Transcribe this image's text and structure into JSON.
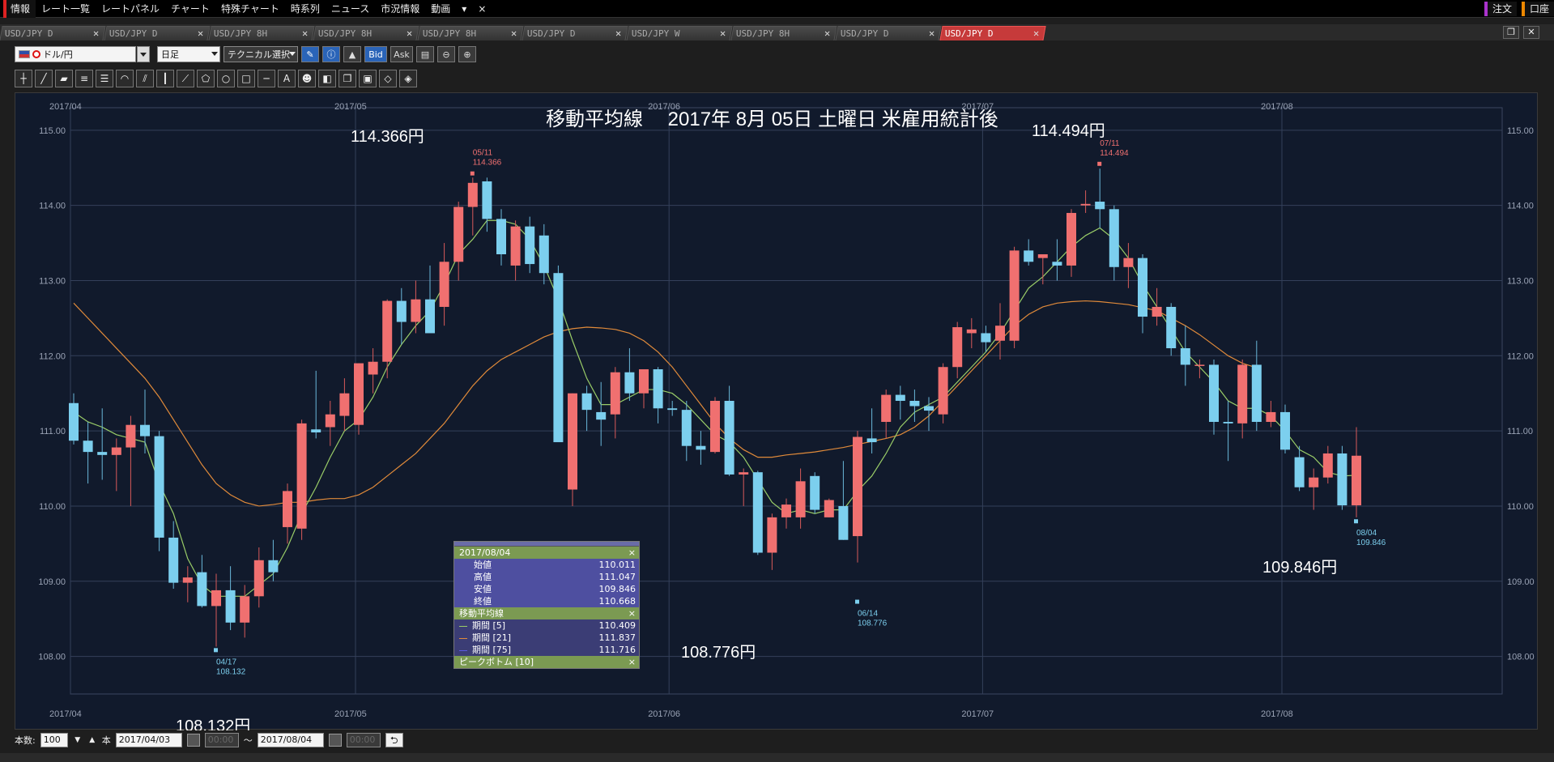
{
  "menu": {
    "items": [
      "情報",
      "レート一覧",
      "レートパネル",
      "チャート",
      "特殊チャート",
      "時系列",
      "ニュース",
      "市況情報",
      "動画"
    ],
    "more": "▾",
    "close": "×",
    "order_button": "注文",
    "account_button": "口座"
  },
  "tabs": [
    {
      "label": "USD/JPY D",
      "active": false
    },
    {
      "label": "USD/JPY D",
      "active": false
    },
    {
      "label": "USD/JPY 8H",
      "active": false
    },
    {
      "label": "USD/JPY 8H",
      "active": false
    },
    {
      "label": "USD/JPY 8H",
      "active": false
    },
    {
      "label": "USD/JPY D",
      "active": false
    },
    {
      "label": "USD/JPY W",
      "active": false
    },
    {
      "label": "USD/JPY 8H",
      "active": false
    },
    {
      "label": "USD/JPY D",
      "active": false
    },
    {
      "label": "USD/JPY D",
      "active": true
    }
  ],
  "toolbar": {
    "pair": "ドル/円",
    "timeframe": "日足",
    "technical": "テクニカル選択",
    "bid": "Bid",
    "ask": "Ask"
  },
  "popup": {
    "date": "2017/08/04",
    "close_x": "×",
    "ohlc": [
      {
        "label": "始値",
        "value": "110.011"
      },
      {
        "label": "高値",
        "value": "111.047"
      },
      {
        "label": "安値",
        "value": "109.846"
      },
      {
        "label": "終値",
        "value": "110.668"
      }
    ],
    "ma_header": "移動平均線",
    "ma": [
      {
        "label": "期間 [5]",
        "value": "110.409",
        "color": "#9acd68"
      },
      {
        "label": "期間 [21]",
        "value": "111.837",
        "color": "#e08a3a"
      },
      {
        "label": "期間 [75]",
        "value": "111.716",
        "color": "#5a5ae0"
      }
    ],
    "peak_header": "ピークボトム [10]"
  },
  "bottom": {
    "count_label": "本数:",
    "count_value": "100",
    "unit": "本",
    "from_date": "2017/04/03",
    "from_time": "00:00",
    "tilde": "〜",
    "to_date": "2017/08/04",
    "to_time": "00:00",
    "undo": "⮌"
  },
  "chart_data": {
    "type": "candlestick",
    "title": "移動平均線 　2017年 8月 05日 土曜日 米雇用統計後",
    "ylim": [
      107.5,
      115.3
    ],
    "y_ticks": [
      "115.00",
      "114.00",
      "113.00",
      "112.00",
      "111.00",
      "110.00",
      "109.00",
      "108.00"
    ],
    "x_month_labels": [
      {
        "label": "2017/04",
        "index": 0
      },
      {
        "label": "2017/05",
        "index": 20
      },
      {
        "label": "2017/06",
        "index": 42
      },
      {
        "label": "2017/07",
        "index": 64
      },
      {
        "label": "2017/08",
        "index": 85
      }
    ],
    "up_color": "#f07070",
    "down_color": "#7ccfee",
    "candles": [
      [
        111.37,
        111.5,
        110.82,
        110.87
      ],
      [
        110.87,
        111.12,
        110.3,
        110.72
      ],
      [
        110.72,
        111.3,
        110.35,
        110.68
      ],
      [
        110.68,
        110.9,
        110.2,
        110.78
      ],
      [
        110.78,
        111.2,
        110.0,
        111.08
      ],
      [
        111.08,
        111.55,
        110.7,
        110.93
      ],
      [
        110.93,
        111.0,
        109.4,
        109.58
      ],
      [
        109.58,
        109.8,
        108.9,
        108.98
      ],
      [
        108.98,
        109.2,
        108.72,
        109.05
      ],
      [
        109.12,
        109.35,
        108.65,
        108.67
      ],
      [
        108.67,
        109.1,
        108.13,
        108.88
      ],
      [
        108.88,
        109.2,
        108.35,
        108.45
      ],
      [
        108.45,
        108.95,
        108.25,
        108.8
      ],
      [
        108.8,
        109.45,
        108.65,
        109.28
      ],
      [
        109.28,
        109.55,
        109.0,
        109.12
      ],
      [
        109.72,
        110.3,
        109.5,
        110.2
      ],
      [
        109.7,
        111.15,
        109.55,
        111.1
      ],
      [
        111.02,
        111.8,
        110.9,
        110.98
      ],
      [
        111.05,
        111.4,
        110.8,
        111.22
      ],
      [
        111.2,
        111.7,
        111.0,
        111.5
      ],
      [
        111.08,
        111.9,
        110.95,
        111.9
      ],
      [
        111.75,
        112.1,
        111.5,
        111.92
      ],
      [
        111.92,
        112.75,
        111.7,
        112.73
      ],
      [
        112.73,
        112.9,
        112.15,
        112.45
      ],
      [
        112.45,
        113.0,
        112.3,
        112.75
      ],
      [
        112.75,
        113.2,
        112.55,
        112.3
      ],
      [
        112.65,
        113.5,
        112.4,
        113.25
      ],
      [
        113.25,
        114.05,
        113.0,
        113.98
      ],
      [
        113.98,
        114.37,
        113.6,
        114.3
      ],
      [
        114.32,
        114.37,
        113.65,
        113.82
      ],
      [
        113.82,
        113.95,
        113.2,
        113.35
      ],
      [
        113.2,
        113.8,
        113.0,
        113.72
      ],
      [
        113.72,
        113.85,
        113.1,
        113.22
      ],
      [
        113.6,
        113.75,
        112.95,
        113.1
      ],
      [
        113.1,
        113.2,
        110.85,
        110.85
      ],
      [
        110.22,
        111.5,
        110.0,
        111.5
      ],
      [
        111.5,
        111.6,
        111.0,
        111.28
      ],
      [
        111.25,
        111.65,
        110.8,
        111.15
      ],
      [
        111.22,
        111.85,
        110.9,
        111.78
      ],
      [
        111.78,
        112.1,
        111.4,
        111.5
      ],
      [
        111.5,
        111.8,
        111.3,
        111.82
      ],
      [
        111.82,
        111.85,
        111.1,
        111.3
      ],
      [
        111.3,
        111.4,
        111.2,
        111.28
      ],
      [
        111.28,
        111.4,
        110.6,
        110.8
      ],
      [
        110.8,
        111.0,
        110.55,
        110.75
      ],
      [
        110.72,
        111.45,
        110.7,
        111.4
      ],
      [
        111.4,
        111.6,
        110.4,
        110.42
      ],
      [
        110.42,
        110.5,
        110.0,
        110.45
      ],
      [
        110.45,
        110.47,
        109.35,
        109.38
      ],
      [
        109.38,
        109.9,
        109.15,
        109.85
      ],
      [
        109.85,
        110.1,
        109.7,
        110.02
      ],
      [
        109.85,
        110.5,
        109.7,
        110.33
      ],
      [
        110.4,
        110.45,
        109.9,
        109.95
      ],
      [
        109.85,
        110.1,
        109.85,
        110.08
      ],
      [
        110.0,
        110.6,
        109.55,
        109.55
      ],
      [
        109.6,
        111.0,
        109.25,
        110.92
      ],
      [
        110.9,
        111.3,
        110.7,
        110.85
      ],
      [
        111.12,
        111.55,
        110.9,
        111.48
      ],
      [
        111.48,
        111.6,
        111.15,
        111.4
      ],
      [
        111.4,
        111.55,
        111.12,
        111.33
      ],
      [
        111.33,
        111.45,
        111.0,
        111.27
      ],
      [
        111.22,
        111.9,
        111.1,
        111.85
      ],
      [
        111.85,
        112.45,
        111.7,
        112.38
      ],
      [
        112.3,
        112.5,
        112.1,
        112.35
      ],
      [
        112.3,
        112.4,
        112.05,
        112.18
      ],
      [
        112.2,
        112.7,
        111.95,
        112.4
      ],
      [
        112.2,
        113.45,
        112.1,
        113.4
      ],
      [
        113.4,
        113.55,
        113.2,
        113.25
      ],
      [
        113.3,
        113.35,
        112.95,
        113.35
      ],
      [
        113.25,
        113.55,
        113.0,
        113.2
      ],
      [
        113.2,
        113.95,
        113.05,
        113.9
      ],
      [
        114.0,
        114.2,
        113.9,
        114.02
      ],
      [
        114.05,
        114.49,
        113.7,
        113.95
      ],
      [
        113.95,
        114.0,
        113.0,
        113.18
      ],
      [
        113.18,
        113.5,
        112.9,
        113.3
      ],
      [
        113.3,
        113.35,
        112.3,
        112.52
      ],
      [
        112.52,
        112.9,
        112.4,
        112.65
      ],
      [
        112.65,
        112.7,
        112.0,
        112.1
      ],
      [
        112.1,
        112.4,
        111.6,
        111.88
      ],
      [
        111.88,
        111.95,
        111.7,
        111.88
      ],
      [
        111.88,
        111.95,
        110.95,
        111.12
      ],
      [
        111.12,
        111.4,
        110.6,
        111.1
      ],
      [
        111.1,
        111.95,
        110.9,
        111.88
      ],
      [
        111.88,
        112.2,
        111.0,
        111.12
      ],
      [
        111.12,
        111.4,
        111.05,
        111.25
      ],
      [
        111.25,
        111.35,
        110.7,
        110.75
      ],
      [
        110.65,
        110.8,
        110.2,
        110.25
      ],
      [
        110.25,
        110.5,
        109.95,
        110.38
      ],
      [
        110.38,
        110.8,
        110.3,
        110.7
      ],
      [
        110.7,
        110.8,
        109.95,
        110.01
      ],
      [
        110.01,
        111.05,
        109.85,
        110.67
      ]
    ],
    "ma5_color": "#9acd68",
    "ma21_color": "#e08a3a",
    "ma75_color": "#5a5ae0",
    "ma5": [
      111.25,
      111.12,
      111.05,
      110.95,
      110.9,
      110.85,
      110.3,
      109.9,
      109.3,
      108.95,
      108.8,
      108.8,
      108.8,
      108.95,
      109.1,
      109.45,
      109.9,
      110.25,
      110.65,
      111.0,
      111.15,
      111.45,
      111.85,
      112.15,
      112.4,
      112.6,
      112.95,
      113.35,
      113.55,
      113.8,
      113.8,
      113.75,
      113.55,
      113.2,
      112.75,
      112.2,
      111.7,
      111.35,
      111.35,
      111.45,
      111.55,
      111.55,
      111.5,
      111.35,
      111.15,
      110.95,
      110.85,
      110.65,
      110.35,
      110.05,
      109.9,
      109.95,
      109.9,
      109.95,
      109.95,
      110.2,
      110.4,
      110.7,
      111.05,
      111.25,
      111.35,
      111.45,
      111.65,
      111.85,
      112.05,
      112.3,
      112.6,
      112.9,
      113.05,
      113.25,
      113.45,
      113.6,
      113.7,
      113.55,
      113.3,
      112.95,
      112.65,
      112.35,
      112.05,
      111.85,
      111.65,
      111.4,
      111.3,
      111.3,
      111.2,
      111.0,
      110.75,
      110.65,
      110.45,
      110.4,
      110.41
    ],
    "ma21": [
      112.7,
      112.5,
      112.3,
      112.1,
      111.9,
      111.7,
      111.45,
      111.15,
      110.85,
      110.55,
      110.3,
      110.15,
      110.05,
      110.0,
      110.02,
      110.05,
      110.05,
      110.08,
      110.1,
      110.1,
      110.15,
      110.25,
      110.4,
      110.55,
      110.7,
      110.9,
      111.1,
      111.35,
      111.6,
      111.8,
      111.95,
      112.05,
      112.15,
      112.25,
      112.32,
      112.36,
      112.38,
      112.37,
      112.35,
      112.3,
      112.2,
      112.05,
      111.85,
      111.6,
      111.35,
      111.1,
      110.9,
      110.75,
      110.65,
      110.65,
      110.68,
      110.7,
      110.72,
      110.75,
      110.78,
      110.82,
      110.86,
      110.9,
      110.95,
      111.05,
      111.2,
      111.4,
      111.6,
      111.8,
      112.0,
      112.2,
      112.4,
      112.55,
      112.65,
      112.7,
      112.72,
      112.73,
      112.72,
      112.7,
      112.68,
      112.64,
      112.6,
      112.5,
      112.4,
      112.28,
      112.14,
      112.0,
      111.9,
      111.84
    ]
  }
}
